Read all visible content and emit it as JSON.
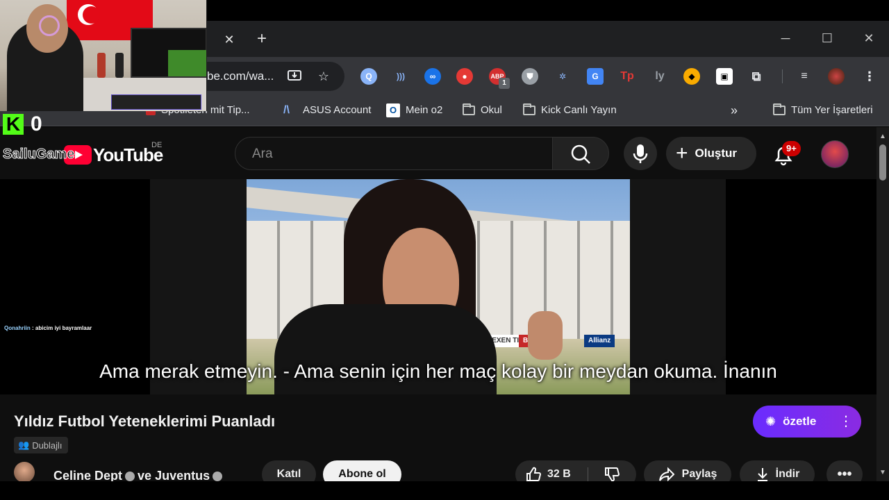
{
  "browser": {
    "url": "be.com/wa...",
    "tab_close": "✕",
    "new_tab": "+",
    "window_controls": {
      "minimize": "─",
      "maximize": "☐",
      "close": "✕"
    },
    "ext_badge": "1",
    "bookmarks": {
      "item_0": "Spotlieten mit Tip...",
      "item_1": "ASUS Account",
      "item_2": "Mein o2",
      "item_3": "Okul",
      "item_4": "Kick Canlı Yayın",
      "overflow": "»",
      "all_bookmarks": "Tüm Yer İşaretleri"
    }
  },
  "kick": {
    "logo": "K",
    "viewer_count": "0"
  },
  "youtube": {
    "logo_text": "YouTube",
    "region": "DE",
    "overlay_name": "SailuGame",
    "search_placeholder": "Ara",
    "create_label": "Oluştur",
    "notifications_badge": "9+",
    "subtitle": "Ama merak etmeyin. - Ama senin için her maç kolay bir meydan okuma. İnanın",
    "video_title": "Yıldız Futbol Yeteneklerimi Puanladı",
    "dubbed_label": "Dublajlı",
    "summarize_label": "özetle",
    "channel_name": "Celine Dept",
    "channel_joiner": "ve",
    "channel_name_2": "Juventus",
    "join_label": "Katıl",
    "subscribe_label": "Abone ol",
    "like_count": "32 B",
    "share_label": "Paylaş",
    "download_label": "İndir",
    "more_label": "•••"
  },
  "chat": {
    "user": "Qonahriin",
    "message": " : abicim iyi bayramlaar"
  },
  "video_ads": {
    "ad_1": "NEXEN TIRE",
    "ad_2": "BA",
    "ad_3": "Allianz"
  },
  "colors": {
    "youtube_bg": "#0f0f0f",
    "kick_green": "#53fc18",
    "summarize_purple": "#7a2cff",
    "notification_red": "#cc0000"
  }
}
